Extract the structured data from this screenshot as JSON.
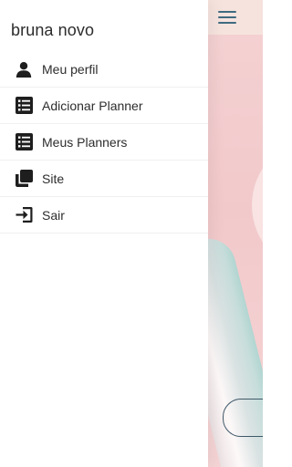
{
  "drawer": {
    "user_name": "bruna novo",
    "items": [
      {
        "label": "Meu perfil",
        "icon": "user-icon"
      },
      {
        "label": "Adicionar Planner",
        "icon": "list-icon"
      },
      {
        "label": "Meus Planners",
        "icon": "list-icon"
      },
      {
        "label": "Site",
        "icon": "copy-icon"
      },
      {
        "label": "Sair",
        "icon": "sign-out-icon"
      }
    ]
  },
  "app": {
    "background_color": "#f2c9cb",
    "menu_icon": "hamburger-icon"
  }
}
